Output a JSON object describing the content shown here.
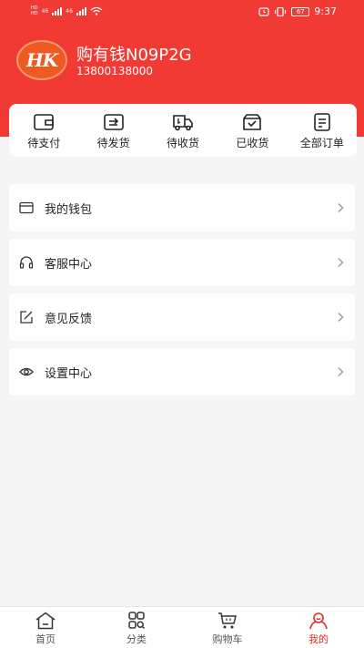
{
  "status_bar": {
    "left_labels": [
      "HD",
      "46",
      "46"
    ],
    "time": "9:37",
    "battery": "67"
  },
  "profile": {
    "avatar_text": "HK",
    "name": "购有钱N09P2G",
    "phone": "13800138000"
  },
  "orders": [
    {
      "label": "待支付",
      "icon": "wallet-icon"
    },
    {
      "label": "待发货",
      "icon": "ship-box-icon"
    },
    {
      "label": "待收货",
      "icon": "truck-icon"
    },
    {
      "label": "已收货",
      "icon": "received-box-icon"
    },
    {
      "label": "全部订单",
      "icon": "order-list-icon"
    }
  ],
  "menu": [
    {
      "label": "我的钱包",
      "icon": "card-icon"
    },
    {
      "label": "客服中心",
      "icon": "headset-icon"
    },
    {
      "label": "意见反馈",
      "icon": "edit-icon"
    },
    {
      "label": "设置中心",
      "icon": "eye-icon"
    }
  ],
  "tabbar": [
    {
      "label": "首页",
      "icon": "home-icon"
    },
    {
      "label": "分类",
      "icon": "category-icon"
    },
    {
      "label": "购物车",
      "icon": "cart-icon"
    },
    {
      "label": "我的",
      "icon": "user-icon",
      "active": true
    }
  ],
  "colors": {
    "accent": "#f23a35",
    "active_tab": "#e22a26",
    "background": "#f5f5f5"
  }
}
